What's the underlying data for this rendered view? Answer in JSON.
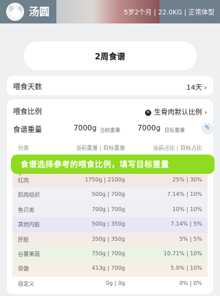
{
  "header": {
    "pet_name": "汤圆",
    "pet_info": "5岁2个月 | 22.0KG | 正常体型"
  },
  "title": "2周食谱",
  "feed_days": {
    "label": "喂食天数",
    "value": "14天"
  },
  "feed_ratio": {
    "label": "喂食比例",
    "value": "生骨肉默认比例",
    "icon": "close-circle-icon"
  },
  "recipe_weight": {
    "label": "食谱重量",
    "current_value": "7000g",
    "current_label": "当前重量",
    "target_value": "7000g",
    "target_label": "目标重量"
  },
  "table": {
    "headers": [
      "分类",
      "当前重量 | 目标重量",
      "当前占比 | 目标占比"
    ],
    "rows": [
      {
        "name": "红肉",
        "weight": "1750g | 2100g",
        "ratio": "25% | 30%",
        "color": "#f4e8e7"
      },
      {
        "name": "肌肉组织",
        "weight": "500g | 700g",
        "ratio": "7.14% | 10%",
        "color": "#f0f0f5"
      },
      {
        "name": "鱼贝类",
        "weight": "700g | 700g",
        "ratio": "10% | 10%",
        "color": "#eef0f3"
      },
      {
        "name": "其他内脏",
        "weight": "500g | 350g",
        "ratio": "7.14% | 5%",
        "color": "#e7e7f5"
      },
      {
        "name": "肝脏",
        "weight": "350g | 350g",
        "ratio": "5% | 5%",
        "color": "#f6ece6"
      },
      {
        "name": "谷薯果蔬",
        "weight": "750g | 700g",
        "ratio": "10.71% | 10%",
        "color": "#eaf3e4"
      },
      {
        "name": "骨骼",
        "weight": "413g | 700g",
        "ratio": "5.9% | 10%",
        "color": "#f6efe6"
      },
      {
        "name": "自定义",
        "weight": "0g | 0g",
        "ratio": "0% | 0%",
        "color": "#ffffff"
      }
    ]
  },
  "banner": "食谱选择参考的喂食比例，填写目标重量",
  "colors": {
    "header_bg": "#6e808c",
    "banner": "#8fdb20",
    "page_bg": "#eef0f1"
  }
}
